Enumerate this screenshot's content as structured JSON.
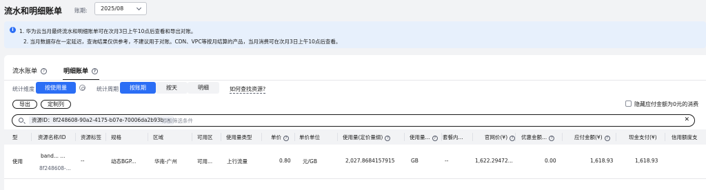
{
  "header": {
    "title": "流水和明细账单",
    "period_label": "账期:",
    "period_value": "2025/08"
  },
  "notice": {
    "line1": "1. 华为云当月最终流水和明细账单可在次月3日上午10点后查看和导出对账。",
    "line2": "2. 当月数据存在一定延迟，查询结果仅供参考，不建议用于对账。CDN、VPC等按月结算的产品，当月消费可在次月3日上午10点后查看。"
  },
  "tabs": [
    {
      "label": "流水账单"
    },
    {
      "label": "明细账单",
      "active": true
    }
  ],
  "filters": {
    "dimension_label": "统计维度",
    "dimension_options": [
      "按使用量"
    ],
    "period_label": "统计周期",
    "period_options": [
      "按账期",
      "按天",
      "明细"
    ],
    "how_to_find": "如何查找资源?"
  },
  "actions": {
    "export": "导出",
    "customize_columns": "定制列",
    "hide_zero": "隐藏应付金额为0元的消费"
  },
  "search": {
    "tag": "资源ID：8f248608-90a2-4175-b07e-70006da2b93b",
    "placeholder": "添加筛选条件"
  },
  "table": {
    "headers": [
      "型",
      "资源名称/ID",
      "资源标签",
      "规格",
      "区域",
      "可用区",
      "使用量类型",
      "单价",
      "单价单位",
      "使用量(定价量纲)",
      "使用量...",
      "套餐内...",
      "官网价(¥)",
      "优惠金额...",
      "应付金额(¥)",
      "现金支付(¥)",
      "信用额度支"
    ],
    "row": {
      "type": "使用",
      "name": "band... ...",
      "id": "8f248608-...",
      "tag": "--",
      "spec": "动态BGP...",
      "region": "华南-广州",
      "az": "可用...",
      "usage_type": "上行流量",
      "unit_price": "0.80",
      "price_unit": "元/GB",
      "usage": "2,027.8684157915",
      "usage_unit": "GB",
      "package": "--",
      "list_price": "1,622.29472...",
      "discount": "0.00",
      "payable": "1,618.93",
      "cash": "1,618.93"
    }
  },
  "colors": {
    "accent": "#2b6ef5",
    "notice_bg": "#e7f0fc"
  }
}
